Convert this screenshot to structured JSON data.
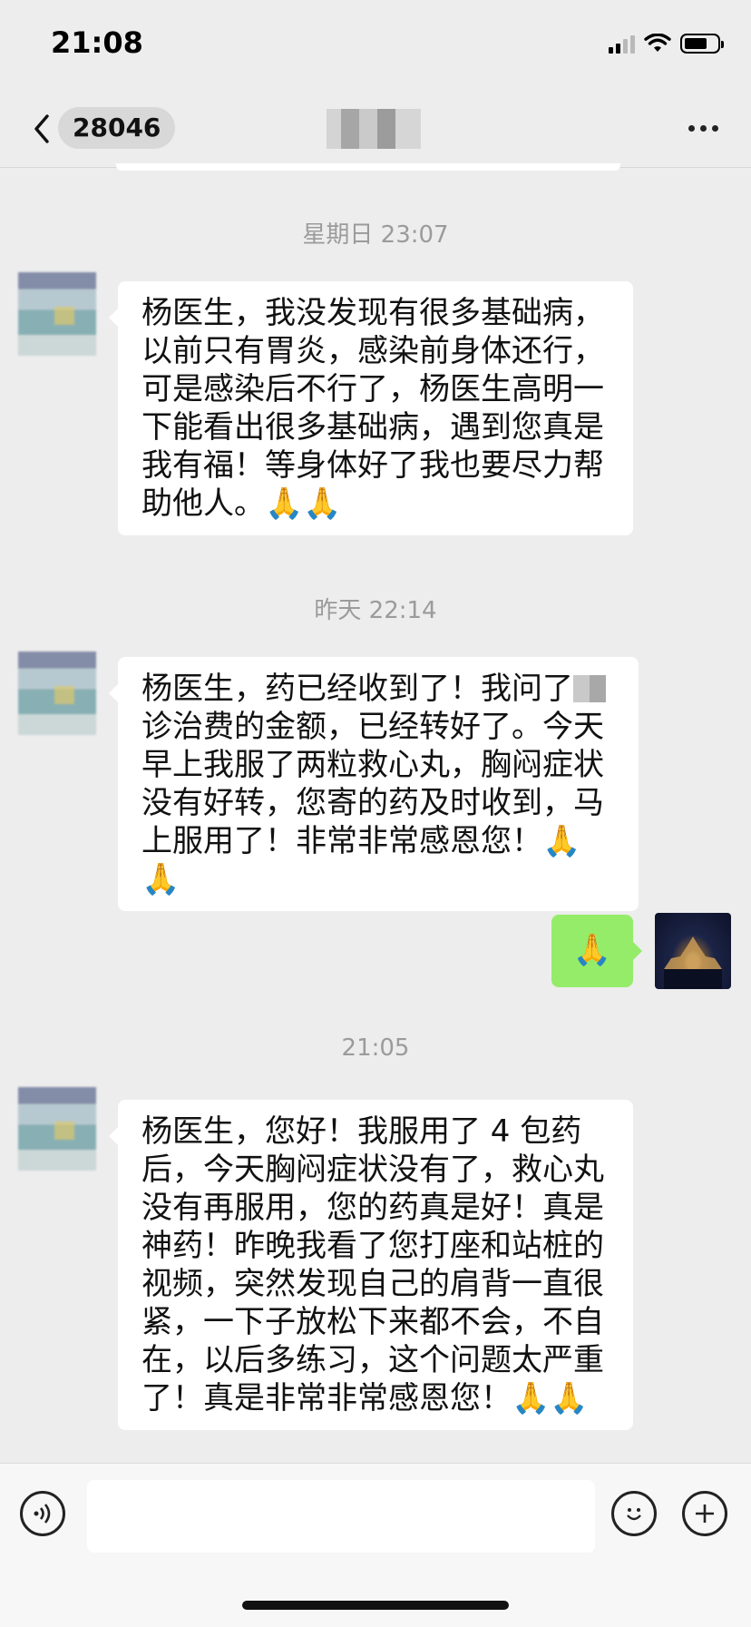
{
  "status_bar": {
    "time": "21:08"
  },
  "header": {
    "unread_count": "28046",
    "title": ""
  },
  "messages": [
    {
      "type": "timestamp",
      "text": "星期日 23:07"
    },
    {
      "type": "incoming",
      "text": "杨医生，我没发现有很多基础病，\n以前只有胃炎，感染前身体还行，\n可是感染后不行了，杨医生高明一\n下能看出很多基础病，遇到您真是\n我有福！等身体好了我也要尽力帮\n助他人。🙏🙏"
    },
    {
      "type": "timestamp",
      "text": "昨天 22:14"
    },
    {
      "type": "incoming",
      "text_before": "杨医生，药已经收到了！我问了",
      "text_after": "\n诊治费的金额，已经转好了。今天\n早上我服了两粒救心丸，胸闷症状\n没有好转，您寄的药及时收到，马\n上服用了！非常非常感恩您！🙏🙏"
    },
    {
      "type": "outgoing",
      "text": "🙏"
    },
    {
      "type": "timestamp",
      "text": "21:05"
    },
    {
      "type": "incoming",
      "text": "杨医生，您好！我服用了 4 包药\n后，今天胸闷症状没有了，救心丸\n没有再服用，您的药真是好！真是\n神药！昨晚我看了您打座和站桩的\n视频，突然发现自己的肩背一直很\n紧，一下子放松下来都不会，不自\n在，以后多练习，这个问题太严重\n了！真是非常非常感恩您！🙏🙏"
    }
  ],
  "input_bar": {
    "placeholder": ""
  },
  "icons": {
    "back": "chevron-left-icon",
    "more": "more-dots-icon",
    "voice": "voice-icon",
    "emoji": "emoji-icon",
    "add": "plus-icon"
  },
  "colors": {
    "background": "#ededed",
    "outgoing_bubble": "#95ec69",
    "incoming_bubble": "#ffffff"
  }
}
